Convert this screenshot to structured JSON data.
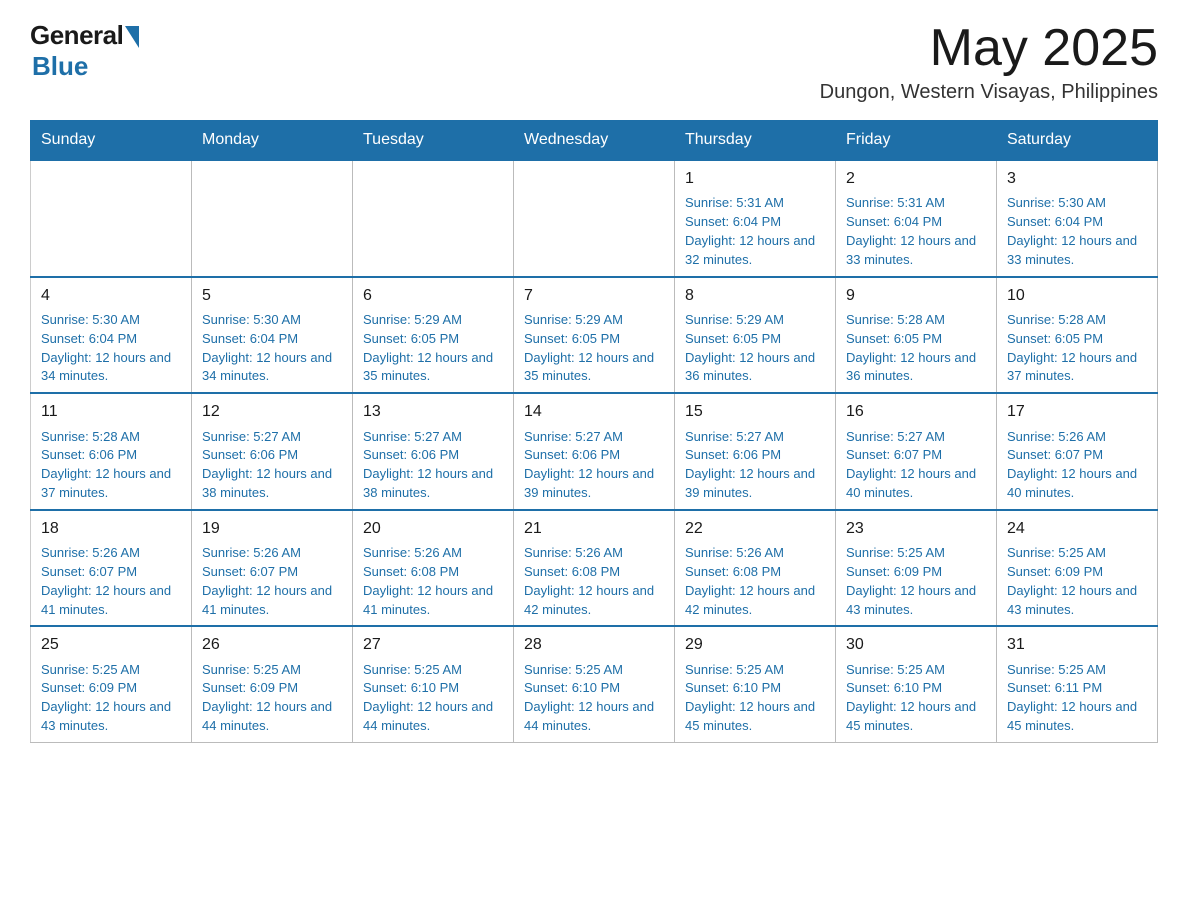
{
  "header": {
    "logo_general": "General",
    "logo_blue": "Blue",
    "month_year": "May 2025",
    "location": "Dungon, Western Visayas, Philippines"
  },
  "days_of_week": [
    "Sunday",
    "Monday",
    "Tuesday",
    "Wednesday",
    "Thursday",
    "Friday",
    "Saturday"
  ],
  "weeks": [
    [
      {
        "day": "",
        "info": ""
      },
      {
        "day": "",
        "info": ""
      },
      {
        "day": "",
        "info": ""
      },
      {
        "day": "",
        "info": ""
      },
      {
        "day": "1",
        "info": "Sunrise: 5:31 AM\nSunset: 6:04 PM\nDaylight: 12 hours and 32 minutes."
      },
      {
        "day": "2",
        "info": "Sunrise: 5:31 AM\nSunset: 6:04 PM\nDaylight: 12 hours and 33 minutes."
      },
      {
        "day": "3",
        "info": "Sunrise: 5:30 AM\nSunset: 6:04 PM\nDaylight: 12 hours and 33 minutes."
      }
    ],
    [
      {
        "day": "4",
        "info": "Sunrise: 5:30 AM\nSunset: 6:04 PM\nDaylight: 12 hours and 34 minutes."
      },
      {
        "day": "5",
        "info": "Sunrise: 5:30 AM\nSunset: 6:04 PM\nDaylight: 12 hours and 34 minutes."
      },
      {
        "day": "6",
        "info": "Sunrise: 5:29 AM\nSunset: 6:05 PM\nDaylight: 12 hours and 35 minutes."
      },
      {
        "day": "7",
        "info": "Sunrise: 5:29 AM\nSunset: 6:05 PM\nDaylight: 12 hours and 35 minutes."
      },
      {
        "day": "8",
        "info": "Sunrise: 5:29 AM\nSunset: 6:05 PM\nDaylight: 12 hours and 36 minutes."
      },
      {
        "day": "9",
        "info": "Sunrise: 5:28 AM\nSunset: 6:05 PM\nDaylight: 12 hours and 36 minutes."
      },
      {
        "day": "10",
        "info": "Sunrise: 5:28 AM\nSunset: 6:05 PM\nDaylight: 12 hours and 37 minutes."
      }
    ],
    [
      {
        "day": "11",
        "info": "Sunrise: 5:28 AM\nSunset: 6:06 PM\nDaylight: 12 hours and 37 minutes."
      },
      {
        "day": "12",
        "info": "Sunrise: 5:27 AM\nSunset: 6:06 PM\nDaylight: 12 hours and 38 minutes."
      },
      {
        "day": "13",
        "info": "Sunrise: 5:27 AM\nSunset: 6:06 PM\nDaylight: 12 hours and 38 minutes."
      },
      {
        "day": "14",
        "info": "Sunrise: 5:27 AM\nSunset: 6:06 PM\nDaylight: 12 hours and 39 minutes."
      },
      {
        "day": "15",
        "info": "Sunrise: 5:27 AM\nSunset: 6:06 PM\nDaylight: 12 hours and 39 minutes."
      },
      {
        "day": "16",
        "info": "Sunrise: 5:27 AM\nSunset: 6:07 PM\nDaylight: 12 hours and 40 minutes."
      },
      {
        "day": "17",
        "info": "Sunrise: 5:26 AM\nSunset: 6:07 PM\nDaylight: 12 hours and 40 minutes."
      }
    ],
    [
      {
        "day": "18",
        "info": "Sunrise: 5:26 AM\nSunset: 6:07 PM\nDaylight: 12 hours and 41 minutes."
      },
      {
        "day": "19",
        "info": "Sunrise: 5:26 AM\nSunset: 6:07 PM\nDaylight: 12 hours and 41 minutes."
      },
      {
        "day": "20",
        "info": "Sunrise: 5:26 AM\nSunset: 6:08 PM\nDaylight: 12 hours and 41 minutes."
      },
      {
        "day": "21",
        "info": "Sunrise: 5:26 AM\nSunset: 6:08 PM\nDaylight: 12 hours and 42 minutes."
      },
      {
        "day": "22",
        "info": "Sunrise: 5:26 AM\nSunset: 6:08 PM\nDaylight: 12 hours and 42 minutes."
      },
      {
        "day": "23",
        "info": "Sunrise: 5:25 AM\nSunset: 6:09 PM\nDaylight: 12 hours and 43 minutes."
      },
      {
        "day": "24",
        "info": "Sunrise: 5:25 AM\nSunset: 6:09 PM\nDaylight: 12 hours and 43 minutes."
      }
    ],
    [
      {
        "day": "25",
        "info": "Sunrise: 5:25 AM\nSunset: 6:09 PM\nDaylight: 12 hours and 43 minutes."
      },
      {
        "day": "26",
        "info": "Sunrise: 5:25 AM\nSunset: 6:09 PM\nDaylight: 12 hours and 44 minutes."
      },
      {
        "day": "27",
        "info": "Sunrise: 5:25 AM\nSunset: 6:10 PM\nDaylight: 12 hours and 44 minutes."
      },
      {
        "day": "28",
        "info": "Sunrise: 5:25 AM\nSunset: 6:10 PM\nDaylight: 12 hours and 44 minutes."
      },
      {
        "day": "29",
        "info": "Sunrise: 5:25 AM\nSunset: 6:10 PM\nDaylight: 12 hours and 45 minutes."
      },
      {
        "day": "30",
        "info": "Sunrise: 5:25 AM\nSunset: 6:10 PM\nDaylight: 12 hours and 45 minutes."
      },
      {
        "day": "31",
        "info": "Sunrise: 5:25 AM\nSunset: 6:11 PM\nDaylight: 12 hours and 45 minutes."
      }
    ]
  ]
}
